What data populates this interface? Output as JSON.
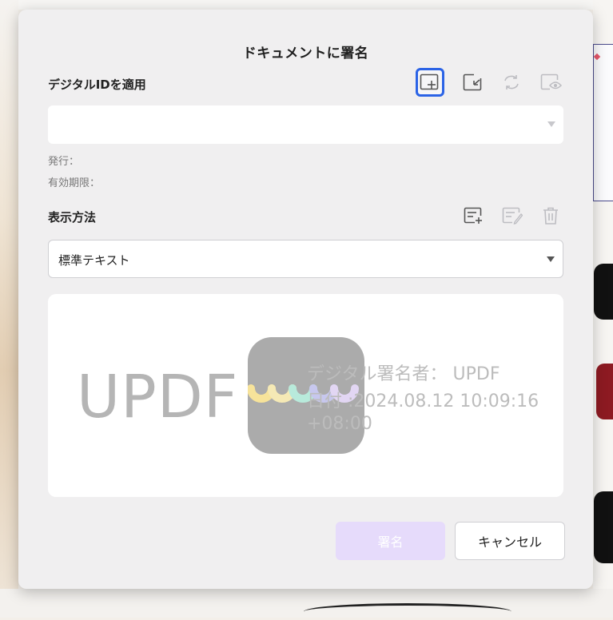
{
  "dialog": {
    "title": "ドキュメントに署名",
    "digital_id": {
      "label": "デジタルIDを適用",
      "value": "",
      "issuer_label": "発行：",
      "validity_label": "有効期限："
    },
    "display": {
      "label": "表示方法",
      "selected": "標準テキスト"
    },
    "preview": {
      "name": "UPDF",
      "signer_line": "デジタル署名者： UPDF",
      "date_line": "日付 :2024.08.12 10:09:16",
      "tz_line": "+08:00"
    },
    "buttons": {
      "sign": "署名",
      "cancel": "キャンセル"
    }
  },
  "colors": {
    "accent_focus": "#2b63e6",
    "sign_button": "#e6dbfb"
  },
  "icons": [
    "add-id-icon",
    "import-id-icon",
    "refresh-icon",
    "view-id-icon",
    "add-style-icon",
    "edit-style-icon",
    "trash-icon"
  ]
}
